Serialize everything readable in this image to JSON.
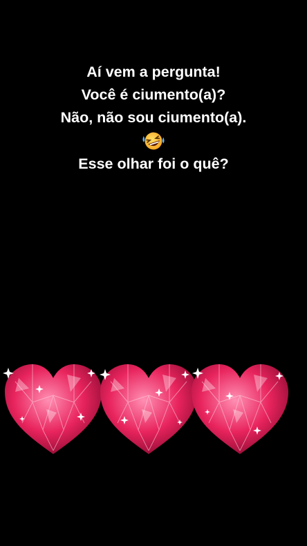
{
  "caption": {
    "line1": "Aí vem a pergunta!",
    "line2": "Você é ciumento(a)?",
    "line3": "Não, não sou ciumento(a).",
    "emoji": "rolling-on-floor-laughing-emoji",
    "line4": "Esse olhar foi o quê?"
  },
  "hearts": {
    "count": 3,
    "icon": "pink-diamond-heart-icon",
    "colors": {
      "light": "#ff6f9c",
      "mid": "#e8245d",
      "dark": "#8e0b33",
      "sparkle": "#ffffff"
    }
  },
  "colors": {
    "background": "#000000",
    "text": "#ffffff"
  }
}
